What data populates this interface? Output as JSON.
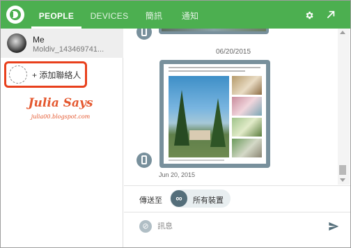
{
  "header": {
    "tabs": [
      {
        "label": "PEOPLE",
        "active": true
      },
      {
        "label": "DEVICES",
        "active": false
      },
      {
        "label": "簡訊",
        "active": false
      },
      {
        "label": "通知",
        "active": false
      }
    ],
    "icons": [
      "pushbullet-logo-icon",
      "gear-icon",
      "popout-arrow-icon"
    ]
  },
  "sidebar": {
    "me": {
      "name": "Me",
      "subtitle": "Moldiv_143469741..."
    },
    "add_contact_label": "+ 添加聯絡人",
    "watermark": {
      "title": "Julia Says",
      "url": "julia00.blogspot.com"
    }
  },
  "chat": {
    "date_separator": "06/20/2015",
    "message_time": "Jun 20, 2015"
  },
  "send_to": {
    "label": "傳送至",
    "target_icon": "∞",
    "target_label": "所有裝置"
  },
  "composer": {
    "placeholder": "訊息",
    "attach_icon": "link-icon",
    "send_icon": "send-icon"
  },
  "colors": {
    "brand": "#4caf50",
    "highlight": "#e8401c",
    "device": "#78909c"
  }
}
